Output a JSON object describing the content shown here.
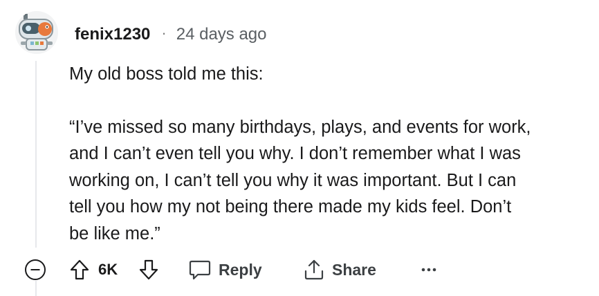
{
  "comment": {
    "username": "fenix1230",
    "separator": "·",
    "timestamp": "24 days ago",
    "body_lines_p1": [
      "My old boss told me this:"
    ],
    "body_lines_p2": [
      "“I’ve missed so many birthdays, plays, and events for work,",
      "and I can’t even tell you why. I don’t remember what I was",
      "working on, I can’t tell you why it was important. But I can",
      "tell you how my not being there made my kids feel. Don’t",
      "be like me.”"
    ]
  },
  "actions": {
    "score": "6K",
    "reply_label": "Reply",
    "share_label": "Share"
  },
  "icons": {
    "collapse": "collapse-minus-icon",
    "upvote": "upvote-arrow-icon",
    "downvote": "downvote-arrow-icon",
    "reply": "speech-bubble-icon",
    "share": "share-upload-icon",
    "more": "ellipsis-icon"
  },
  "colors": {
    "text": "#1a1a1b",
    "muted": "#5a5f63",
    "thread_line": "#e6e8eb"
  }
}
